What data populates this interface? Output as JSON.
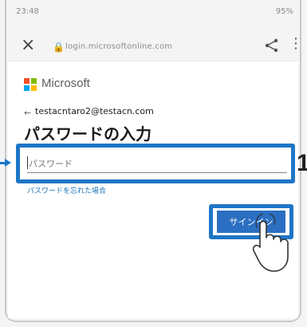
{
  "status_bar": {
    "time": "23:48",
    "right": "95%"
  },
  "browser": {
    "url": "login.microsoftonline.com"
  },
  "brand": {
    "name": "Microsoft",
    "logo_colors": [
      "#f25022",
      "#7fba00",
      "#00a4ef",
      "#ffb900"
    ]
  },
  "login": {
    "email": "testacntaro2@testacn.com",
    "back_symbol": "←",
    "heading": "パスワードの入力",
    "password_placeholder": "パスワード",
    "forgot_link": "パスワードを忘れた場合",
    "signin_label": "サインイン"
  },
  "annotation": {
    "step": "1",
    "highlight_color": "#1e76c6"
  }
}
